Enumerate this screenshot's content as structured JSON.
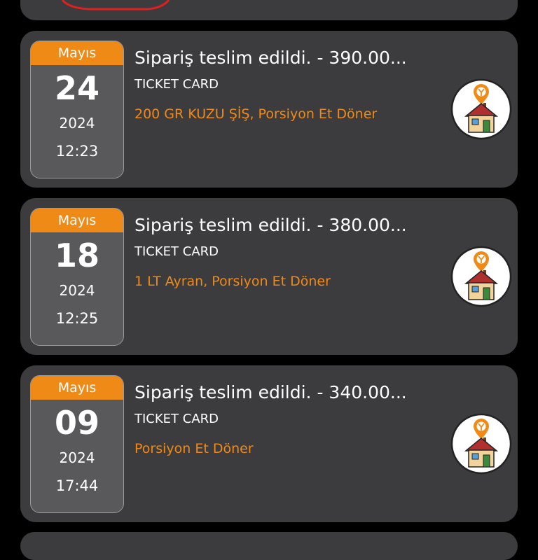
{
  "orders": [
    {
      "month": "Mayıs",
      "day": "24",
      "year": "2024",
      "time": "12:23",
      "title": "Sipariş teslim edildi. - 390.00...",
      "payment": "TICKET CARD",
      "items": "200 GR KUZU ŞİŞ, Porsiyon Et Döner"
    },
    {
      "month": "Mayıs",
      "day": "18",
      "year": "2024",
      "time": "12:25",
      "title": "Sipariş teslim edildi. - 380.00...",
      "payment": "TICKET CARD",
      "items": "1 LT Ayran, Porsiyon Et Döner"
    },
    {
      "month": "Mayıs",
      "day": "09",
      "year": "2024",
      "time": "17:44",
      "title": "Sipariş teslim edildi. - 340.00...",
      "payment": "TICKET CARD",
      "items": "Porsiyon Et Döner"
    }
  ],
  "colors": {
    "accent": "#f08a17",
    "card": "#3c3c3e",
    "date_box": "#59595b",
    "background": "#000000",
    "annotation": "#e02020"
  },
  "icons": {
    "restaurant_logo": "home-location-pin-icon"
  }
}
